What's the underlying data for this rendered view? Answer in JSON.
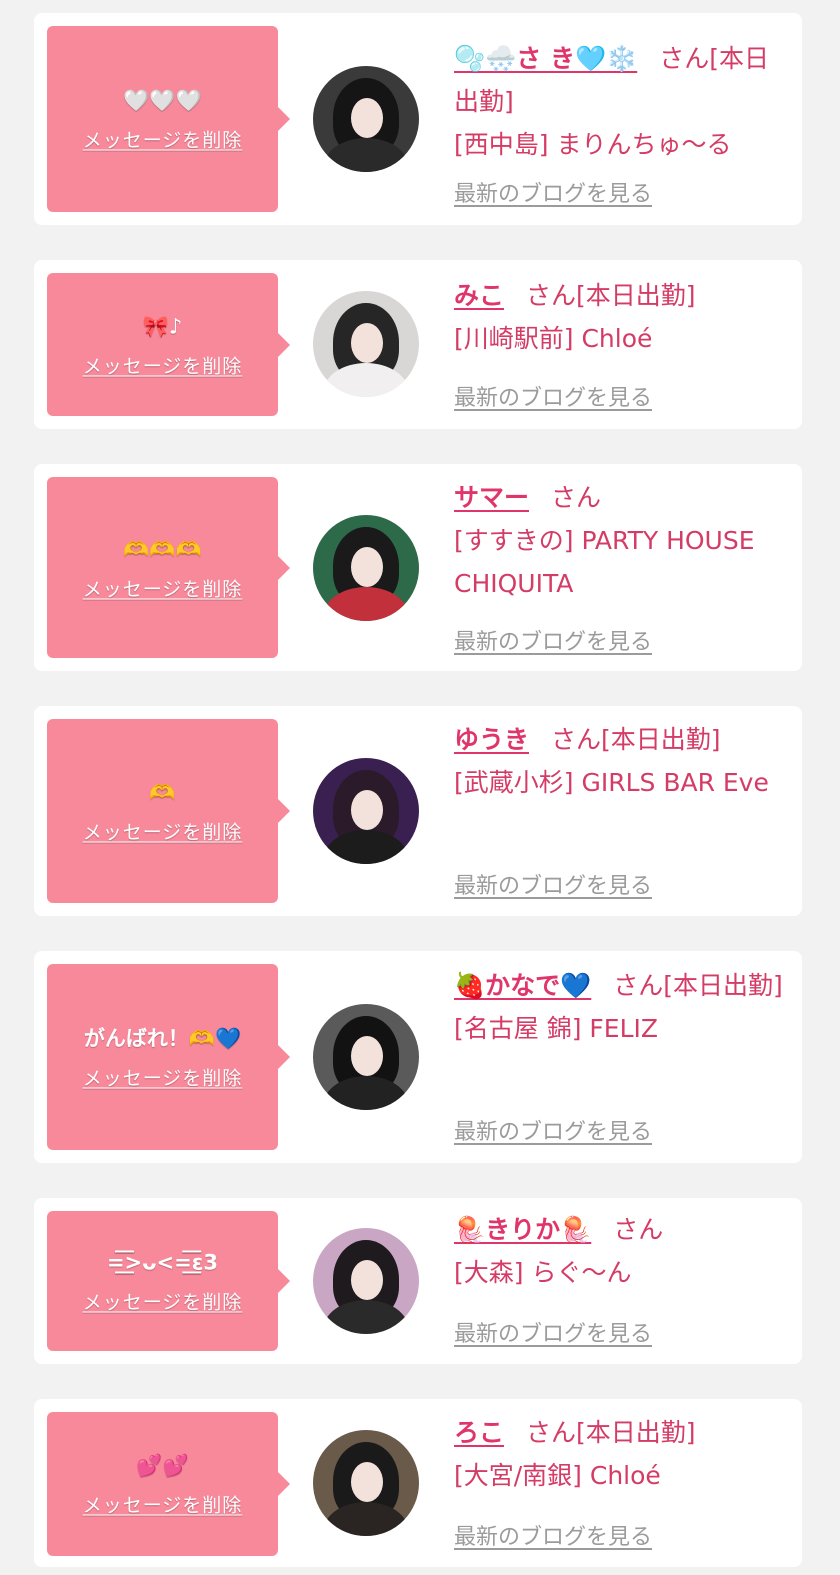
{
  "common": {
    "delete_label": "メッセージを削除",
    "blog_label": "最新のブログを見る",
    "san": "さん"
  },
  "items": [
    {
      "message": "🤍🤍🤍",
      "name": "🫧🌨️さ き🩵❄️",
      "status": "[本日出勤]",
      "store": "[西中島] まりんちゅ〜る",
      "avatar_colors": {
        "bg": "#3a3a3a",
        "hair": "#151515",
        "body": "#2a2a2a"
      }
    },
    {
      "message": "🎀♪",
      "name": "みこ",
      "status": "[本日出勤]",
      "store": "[川崎駅前] Chloé",
      "avatar_colors": {
        "bg": "#d9d6d6",
        "hair": "#262626",
        "body": "#f1efef"
      }
    },
    {
      "message": "🫶🫶🫶",
      "name": "サマー",
      "status": "",
      "store": "[すすきの] PARTY HOUSE CHIQUITA",
      "avatar_colors": {
        "bg": "#2d6a4a",
        "hair": "#1a1a1a",
        "body": "#c2303b"
      }
    },
    {
      "message": "🫶",
      "name": "ゆうき",
      "status": "[本日出勤]",
      "store": "[武蔵小杉] GIRLS BAR Eve",
      "avatar_colors": {
        "bg": "#3a2050",
        "hair": "#2a1a2a",
        "body": "#1c1c1c"
      }
    },
    {
      "message": "がんばれ！🫶💙",
      "name": "🍓かなで💙",
      "status": "[本日出勤]",
      "store": "[名古屋 錦] FELIZ",
      "avatar_colors": {
        "bg": "#5a5a5a",
        "hair": "#121212",
        "body": "#222222"
      }
    },
    {
      "message": "=͟͟͞͞>ᴗ<=͟͟͞͞ε3",
      "name": "🪼きりか🪼",
      "status": "",
      "store": "[大森] らぐ〜ん",
      "avatar_colors": {
        "bg": "#c9a6c4",
        "hair": "#1e1a1e",
        "body": "#2a2a2a"
      }
    },
    {
      "message": "💕💕",
      "name": "ろこ",
      "status": "[本日出勤]",
      "store": "[大宮/南銀] Chloé",
      "avatar_colors": {
        "bg": "#6a5a4a",
        "hair": "#1a1a1a",
        "body": "#2a2522"
      }
    }
  ]
}
